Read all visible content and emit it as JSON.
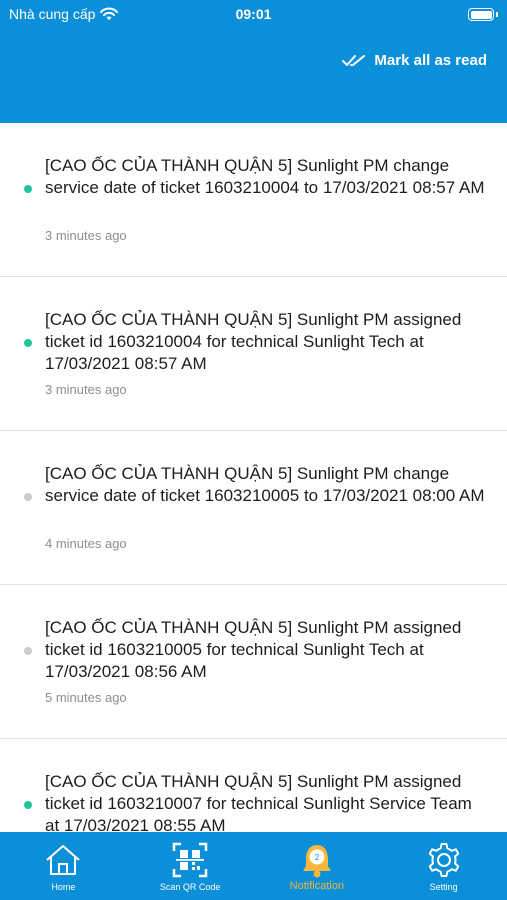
{
  "status_bar": {
    "carrier": "Nhà cung cấp",
    "time": "09:01"
  },
  "header": {
    "mark_all_label": "Mark all as read"
  },
  "notifications": [
    {
      "text": "[CAO ỐC CỦA THÀNH QUẬN 5] Sunlight PM change service date of ticket 1603210004 to 17/03/2021 08:57 AM",
      "time": "3 minutes ago",
      "unread": true
    },
    {
      "text": "[CAO ỐC CỦA THÀNH QUẬN 5] Sunlight PM assigned ticket id 1603210004 for technical Sunlight Tech at 17/03/2021 08:57 AM",
      "time": "3 minutes ago",
      "unread": true
    },
    {
      "text": "[CAO ỐC CỦA THÀNH QUẬN 5] Sunlight PM change service date of ticket 1603210005 to 17/03/2021 08:00 AM",
      "time": "4 minutes ago",
      "unread": false
    },
    {
      "text": "[CAO ỐC CỦA THÀNH QUẬN 5] Sunlight PM assigned ticket id 1603210005 for technical Sunlight Tech at 17/03/2021 08:56 AM",
      "time": "5 minutes ago",
      "unread": false
    },
    {
      "text": "[CAO ỐC CỦA THÀNH QUẬN 5] Sunlight PM assigned ticket id 1603210007 for technical Sunlight Service Team at 17/03/2021 08:55 AM",
      "time": "",
      "unread": true
    }
  ],
  "tabs": [
    {
      "label": "Home",
      "icon": "home-icon"
    },
    {
      "label": "Scan QR Code",
      "icon": "qr-code-icon"
    },
    {
      "label": "Notification",
      "icon": "bell-icon",
      "active": true
    },
    {
      "label": "Setting",
      "icon": "gear-icon"
    }
  ],
  "colors": {
    "primary": "#0a8fd8",
    "unread_dot": "#1fc59a",
    "read_dot": "#cccccc",
    "active_tab": "#f6b73c"
  }
}
